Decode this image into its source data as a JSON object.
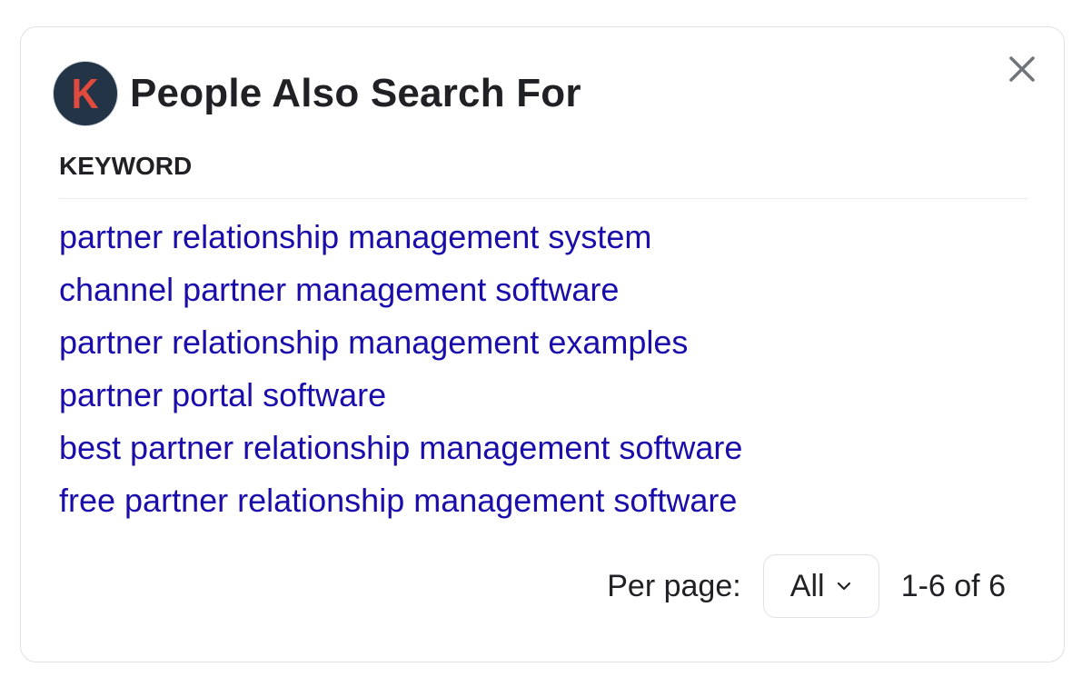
{
  "widget": {
    "logo_letter": "K",
    "title": "People Also Search For",
    "close_icon": "close-icon",
    "column_header": "KEYWORD"
  },
  "keywords": [
    "partner relationship management system",
    "channel partner management software",
    "partner relationship management examples",
    "partner portal software",
    "best partner relationship management software",
    "free partner relationship management software"
  ],
  "pagination": {
    "per_page_label": "Per page:",
    "per_page_value": "All",
    "range_text": "1-6 of 6"
  },
  "colors": {
    "link": "#1a0dab",
    "text": "#202124",
    "logo_bg": "#233446",
    "logo_letter": "#e04a3f"
  }
}
